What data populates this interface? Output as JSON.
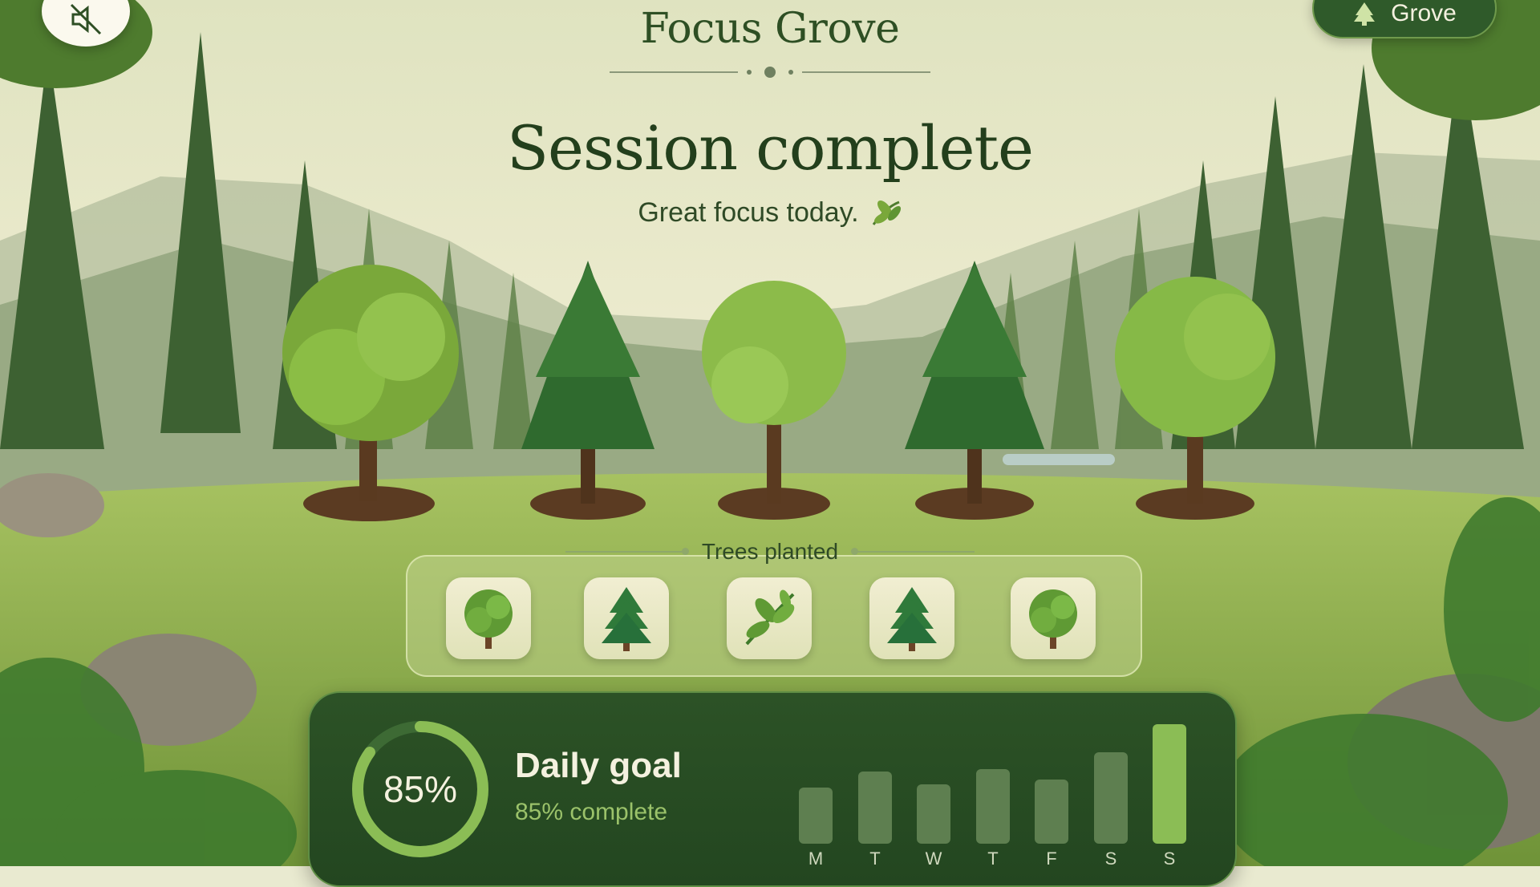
{
  "app": {
    "brand": "Focus Grove",
    "grove_button_label": "Grove",
    "mute_button_icon": "sound-off-icon",
    "grove_button_icon": "pine-tree-icon"
  },
  "session": {
    "headline": "Session complete",
    "subline": "Great focus today.",
    "subline_icon": "leaf-icon"
  },
  "trees_planted": {
    "label": "Trees planted",
    "items": [
      {
        "icon": "deciduous-tree-icon"
      },
      {
        "icon": "pine-tree-icon"
      },
      {
        "icon": "leaf-sprig-icon"
      },
      {
        "icon": "pine-tree-icon"
      },
      {
        "icon": "deciduous-tree-icon"
      }
    ]
  },
  "daily_goal": {
    "title": "Daily goal",
    "percent_label": "85%",
    "status": "85% complete",
    "progress": 0.85
  },
  "chart_data": {
    "type": "bar",
    "categories": [
      "M",
      "T",
      "W",
      "T",
      "F",
      "S",
      "S"
    ],
    "values": [
      0.44,
      0.56,
      0.46,
      0.58,
      0.5,
      0.71,
      0.93
    ],
    "highlight_index": 6
  },
  "colors": {
    "accent": "#8bbd55",
    "card": "#2c5226",
    "brand_text": "#2e4f24"
  }
}
